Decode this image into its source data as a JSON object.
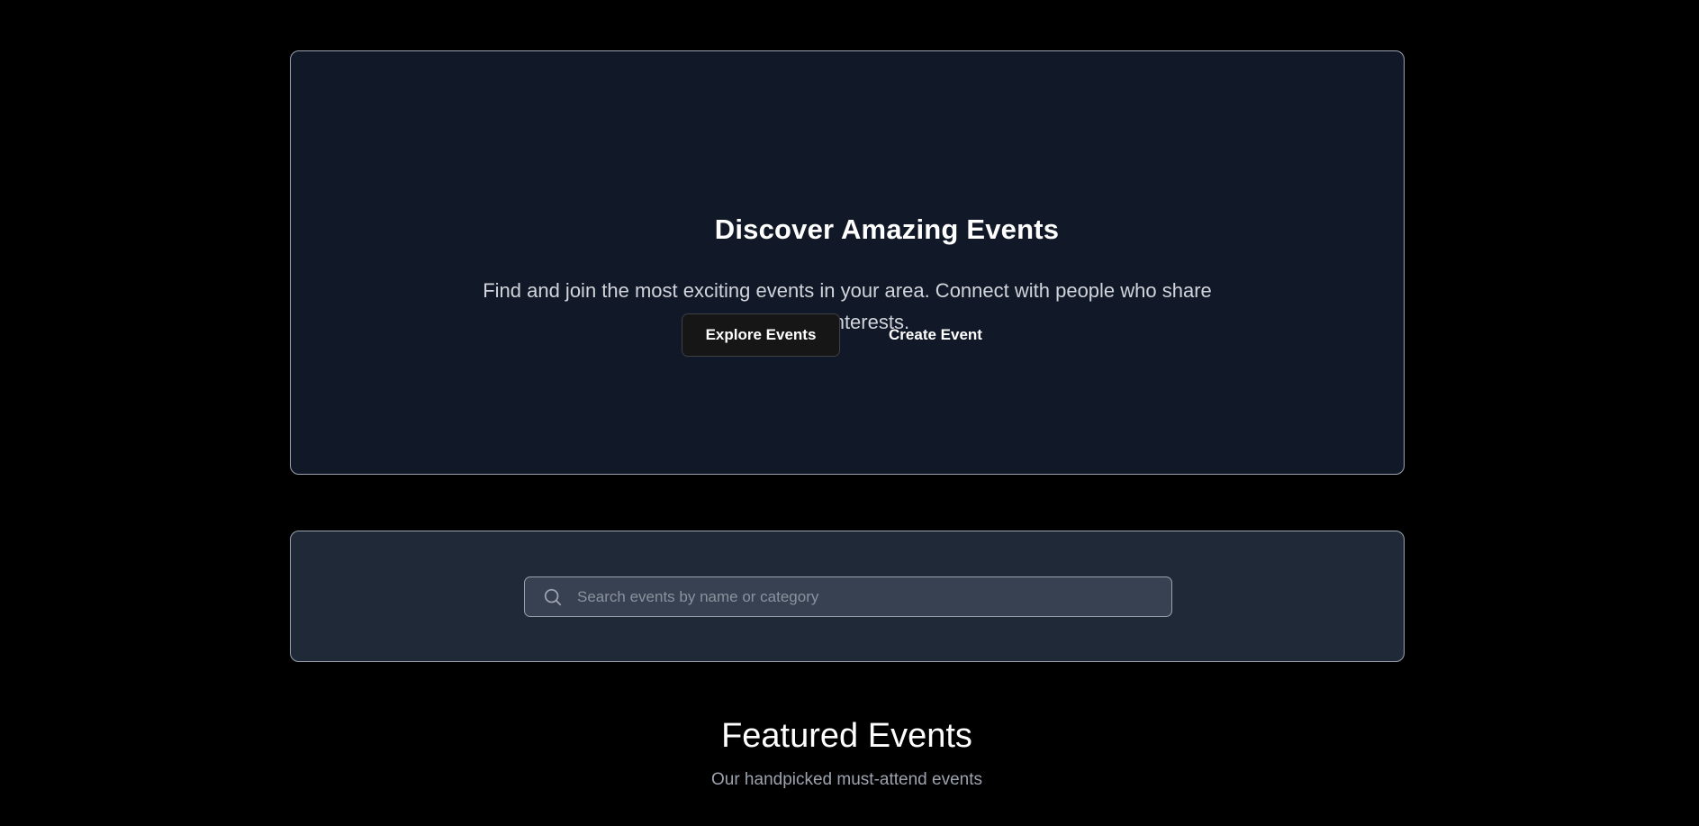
{
  "hero": {
    "title": "Discover Amazing Events",
    "description": "Find and join the most exciting events in your area. Connect with people who share your interests.",
    "explore_button": "Explore Events",
    "create_button": "Create Event"
  },
  "search": {
    "placeholder": "Search events by name or category",
    "icon": "search-icon"
  },
  "featured": {
    "title": "Featured Events",
    "subtitle": "Our handpicked must-attend events"
  },
  "colors": {
    "page_background": "#000000",
    "hero_background": "#111827",
    "search_panel_background": "#1f2937",
    "search_input_background": "#374151",
    "border": "#9ca3af"
  }
}
